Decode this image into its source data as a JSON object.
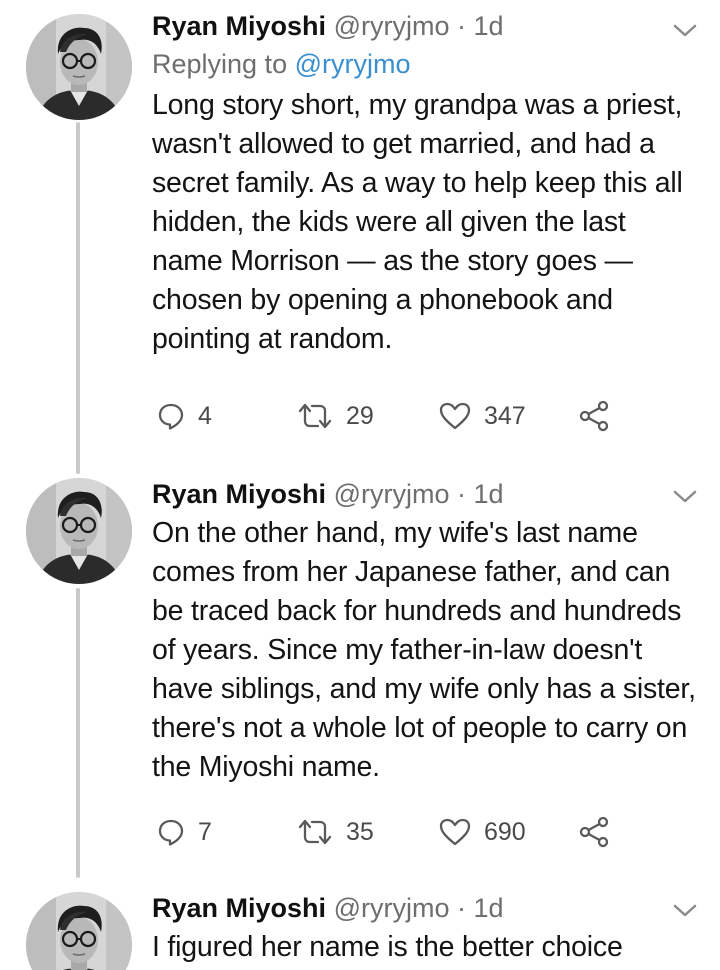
{
  "tweets": [
    {
      "author": "Ryan Miyoshi",
      "handle": "@ryryjmo",
      "separator": "·",
      "time": "1d",
      "reply_prefix": "Replying to",
      "reply_mention": "@ryryjmo",
      "text": "Long story short, my grandpa was a priest, wasn't allowed to get married, and had a secret family. As a way to help keep this all hidden, the kids were all given the last name Morrison — as the story goes — chosen by opening a phonebook and pointing at random.",
      "replies": "4",
      "retweets": "29",
      "likes": "347"
    },
    {
      "author": "Ryan Miyoshi",
      "handle": "@ryryjmo",
      "separator": "·",
      "time": "1d",
      "text": "On the other hand, my wife's last name comes from her Japanese father, and can be traced back for hundreds and hundreds of years. Since my father-in-law doesn't have siblings, and my wife only has a sister, there's not a whole lot of people to carry on the Miyoshi name.",
      "replies": "7",
      "retweets": "35",
      "likes": "690"
    },
    {
      "author": "Ryan Miyoshi",
      "handle": "@ryryjmo",
      "separator": "·",
      "time": "1d",
      "text": "I figured her name is the better choice"
    }
  ],
  "icons": {
    "reply": "reply-icon",
    "retweet": "retweet-icon",
    "like": "heart-icon",
    "share": "share-icon",
    "menu": "chevron-down-icon"
  },
  "colors": {
    "mention": "#3a8fd1",
    "muted": "#6e6e6e",
    "thread_line": "#c9c9c9"
  }
}
